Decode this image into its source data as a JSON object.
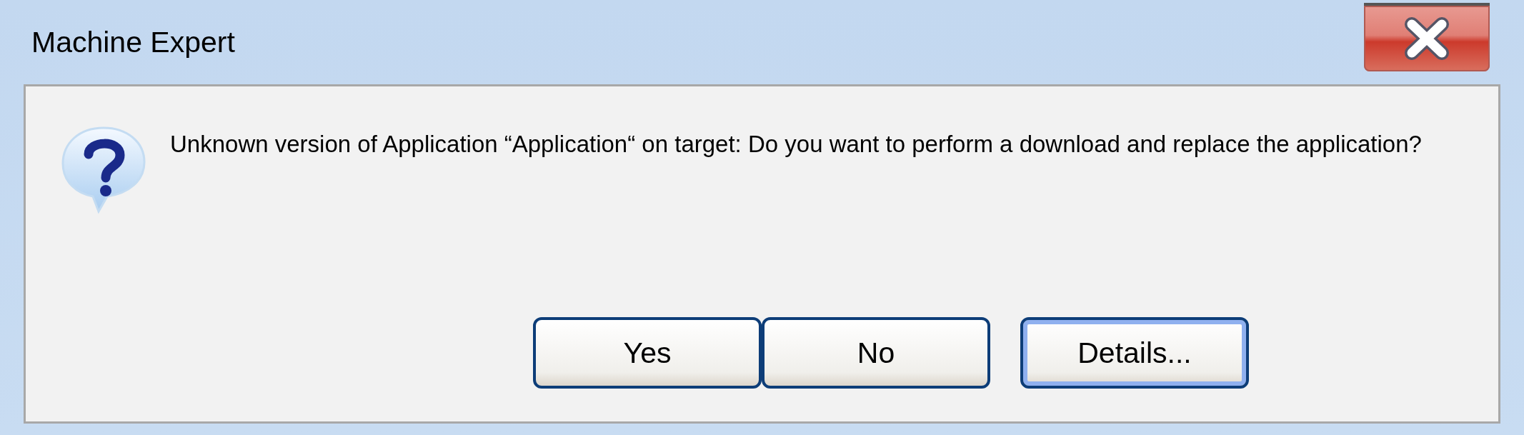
{
  "window": {
    "title": "Machine Expert"
  },
  "message": "Unknown version of Application “Application“ on target: Do you want to perform a download and replace the application?",
  "buttons": [
    {
      "label": "Yes",
      "focused": false
    },
    {
      "label": "No",
      "focused": false
    },
    {
      "label": "Details...",
      "focused": true
    }
  ]
}
